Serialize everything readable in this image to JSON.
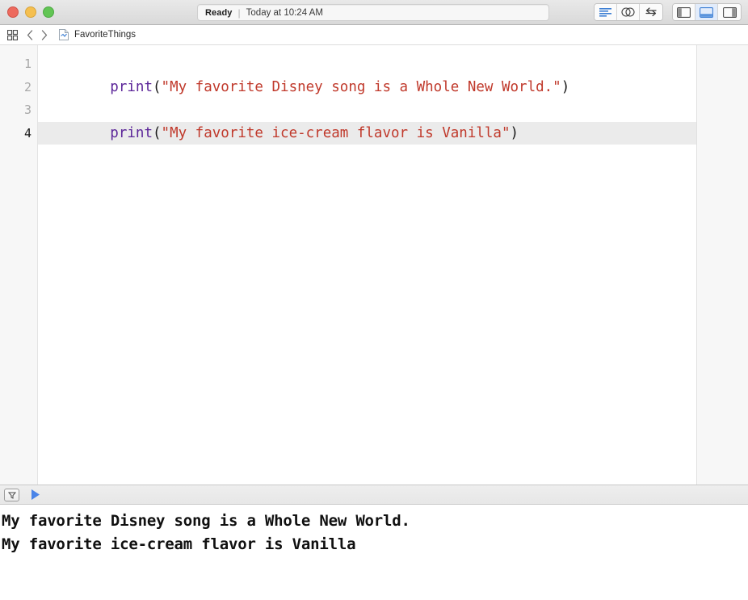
{
  "window": {
    "traffic_lights": [
      {
        "name": "close",
        "color": "#ed6a5e"
      },
      {
        "name": "minimize",
        "color": "#f5bf4f"
      },
      {
        "name": "maximize",
        "color": "#62c554"
      }
    ]
  },
  "toolbar": {
    "status": {
      "state": "Ready",
      "separator": "|",
      "time": "Today at 10:24 AM"
    },
    "editor_modes": [
      {
        "icon": "standard-editor-icon",
        "active": false
      },
      {
        "icon": "assistant-editor-icon",
        "active": false
      },
      {
        "icon": "version-editor-icon",
        "active": false
      }
    ],
    "panel_toggles": [
      {
        "icon": "navigator-panel-icon",
        "active": false
      },
      {
        "icon": "debug-panel-icon",
        "active": true
      },
      {
        "icon": "utilities-panel-icon",
        "active": false
      }
    ]
  },
  "breadcrumb": {
    "grid_icon": "grid-icon",
    "back_icon": "chevron-left-icon",
    "forward_icon": "chevron-right-icon",
    "file_icon": "playground-file-icon",
    "file_name": "FavoriteThings"
  },
  "editor": {
    "line_numbers": [
      "1",
      "2",
      "3",
      "4"
    ],
    "current_line": 4,
    "lines": [
      {
        "number": "1",
        "tokens": [
          {
            "type": "kw",
            "text": "print"
          },
          {
            "type": "punc",
            "text": "("
          },
          {
            "type": "str",
            "text": "\"My favorite Disney song is a Whole New World.\""
          },
          {
            "type": "punc",
            "text": ")"
          }
        ]
      },
      {
        "number": "2",
        "tokens": []
      },
      {
        "number": "3",
        "tokens": [
          {
            "type": "kw",
            "text": "print"
          },
          {
            "type": "punc",
            "text": "("
          },
          {
            "type": "str",
            "text": "\"My favorite ice-cream flavor is Vanilla\""
          },
          {
            "type": "punc",
            "text": ")"
          }
        ]
      },
      {
        "number": "4",
        "tokens": []
      }
    ],
    "colors": {
      "keyword": "#5c2699",
      "string": "#c0392b",
      "punctuation": "#1a1a1a",
      "current_line_highlight": "#ebebeb",
      "gutter_background": "#f7f7f7"
    }
  },
  "console": {
    "filter_icon": "filter-dropdown-icon",
    "run_icon": "run-play-icon",
    "run_icon_color": "#4a84e8",
    "output_lines": [
      "My favorite Disney song is a Whole New World.",
      "My favorite ice-cream flavor is Vanilla"
    ]
  }
}
